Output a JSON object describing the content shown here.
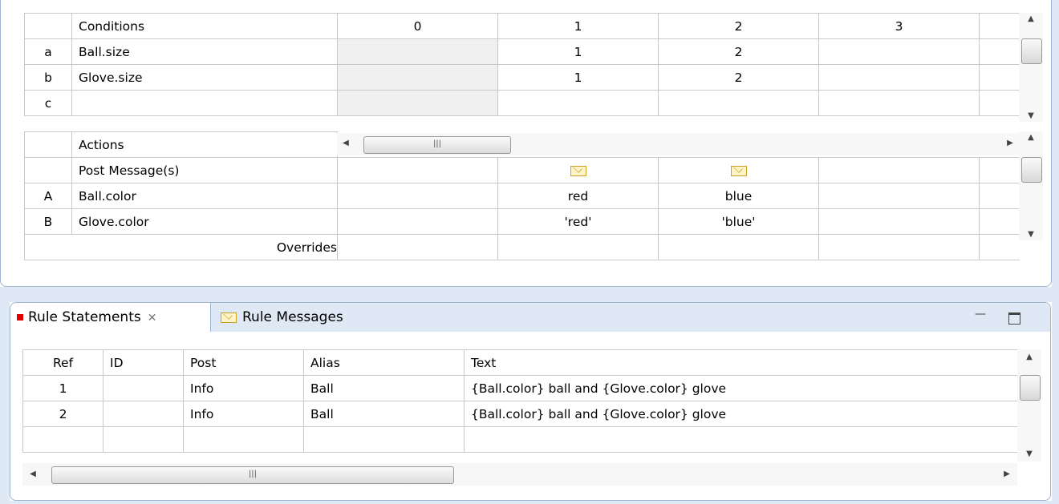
{
  "decision_table": {
    "columns": [
      "0",
      "1",
      "2",
      "3"
    ],
    "conditions": {
      "header": "Conditions",
      "rows": [
        {
          "id": "a",
          "name": "Ball.size",
          "values": [
            "",
            "1",
            "2",
            ""
          ]
        },
        {
          "id": "b",
          "name": "Glove.size",
          "values": [
            "",
            "1",
            "2",
            ""
          ]
        },
        {
          "id": "c",
          "name": "",
          "values": [
            "",
            "",
            "",
            ""
          ]
        }
      ]
    },
    "actions": {
      "header": "Actions",
      "post_messages_label": "Post Message(s)",
      "post_message_icon": "envelope-icon",
      "rows": [
        {
          "id": "A",
          "name": "Ball.color",
          "values": [
            "",
            "red",
            "blue",
            ""
          ]
        },
        {
          "id": "B",
          "name": "Glove.color",
          "values": [
            "",
            "'red'",
            "'blue'",
            ""
          ]
        }
      ]
    },
    "overrides_label": "Overrides"
  },
  "bottom_view": {
    "tabs": [
      {
        "label": "Rule Statements",
        "active": true,
        "icon": "red-square-icon"
      },
      {
        "label": "Rule Messages",
        "active": false,
        "icon": "envelope-icon"
      }
    ],
    "table": {
      "headers": [
        "Ref",
        "ID",
        "Post",
        "Alias",
        "Text"
      ],
      "rows": [
        [
          "1",
          "",
          "Info",
          "Ball",
          "{Ball.color} ball and {Glove.color} glove"
        ],
        [
          "2",
          "",
          "Info",
          "Ball",
          "{Ball.color} ball and {Glove.color} glove"
        ],
        [
          "",
          "",
          "",
          "",
          ""
        ]
      ]
    },
    "minimize_icon": "minimize-icon",
    "maximize_icon": "maximize-icon"
  },
  "colors": {
    "border": "#c9c9c9",
    "panel_border": "#9fb5d0",
    "background": "#dfe8f5",
    "tab_active_marker": "#e00000"
  }
}
